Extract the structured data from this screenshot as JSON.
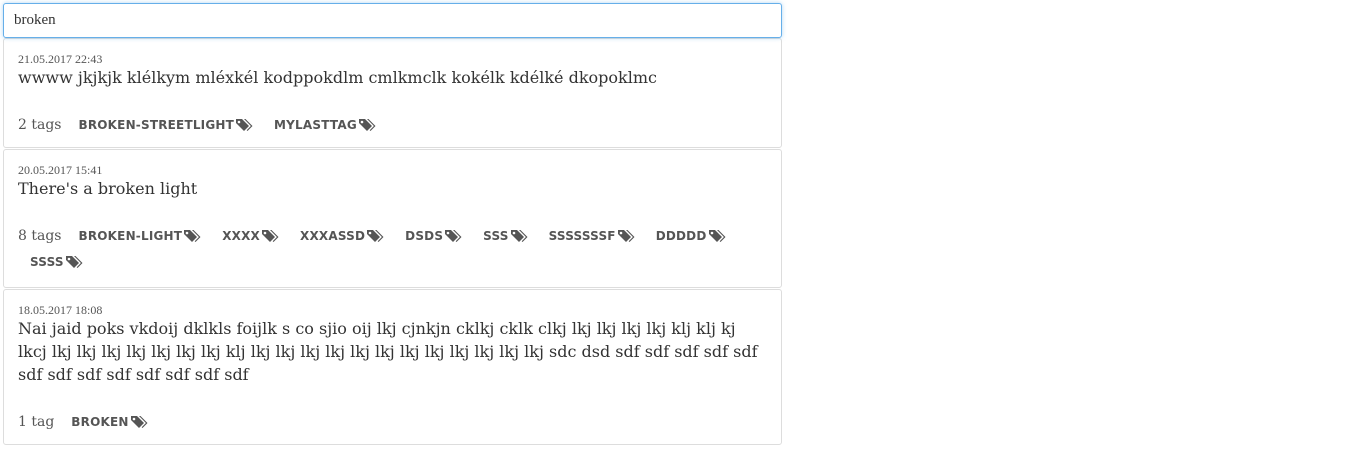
{
  "search": {
    "value": "broken"
  },
  "posts": [
    {
      "date": "21.05.2017 22:43",
      "text": "wwww jkjkjk klélkym mléxkél kodppokdlm cmlkmclk kokélk kdélké dkopoklmc",
      "tag_count": "2 tags",
      "tags": [
        "BROKEN-STREETLIGHT",
        "MYLASTTAG"
      ]
    },
    {
      "date": "20.05.2017 15:41",
      "text": "There's a broken light",
      "tag_count": "8 tags",
      "tags": [
        "BROKEN-LIGHT",
        "XXXX",
        "XXXASSD",
        "DSDS",
        "SSS",
        "SSSSSSSF",
        "DDDDD",
        "SSSS"
      ]
    },
    {
      "date": "18.05.2017 18:08",
      "text": "Nai jaid poks vkdoij dklkls foijlk s co sjio oij lkj cjnkjn cklkj cklk clkj lkj lkj lkj lkj klj klj kj lkcj lkj lkj lkj lkj lkj lkj lkj klj lkj lkj lkj lkj lkj lkj lkj lkj lkj lkj lkj lkj sdc dsd sdf sdf sdf sdf sdf sdf sdf sdf sdf sdf sdf sdf sdf",
      "tag_count": "1 tag",
      "tags": [
        "BROKEN"
      ]
    }
  ],
  "icons": {
    "tag": "tags-icon"
  },
  "colors": {
    "focus_border": "#66afe9",
    "card_border": "#dddddd",
    "text": "#333333",
    "muted": "#555555"
  }
}
